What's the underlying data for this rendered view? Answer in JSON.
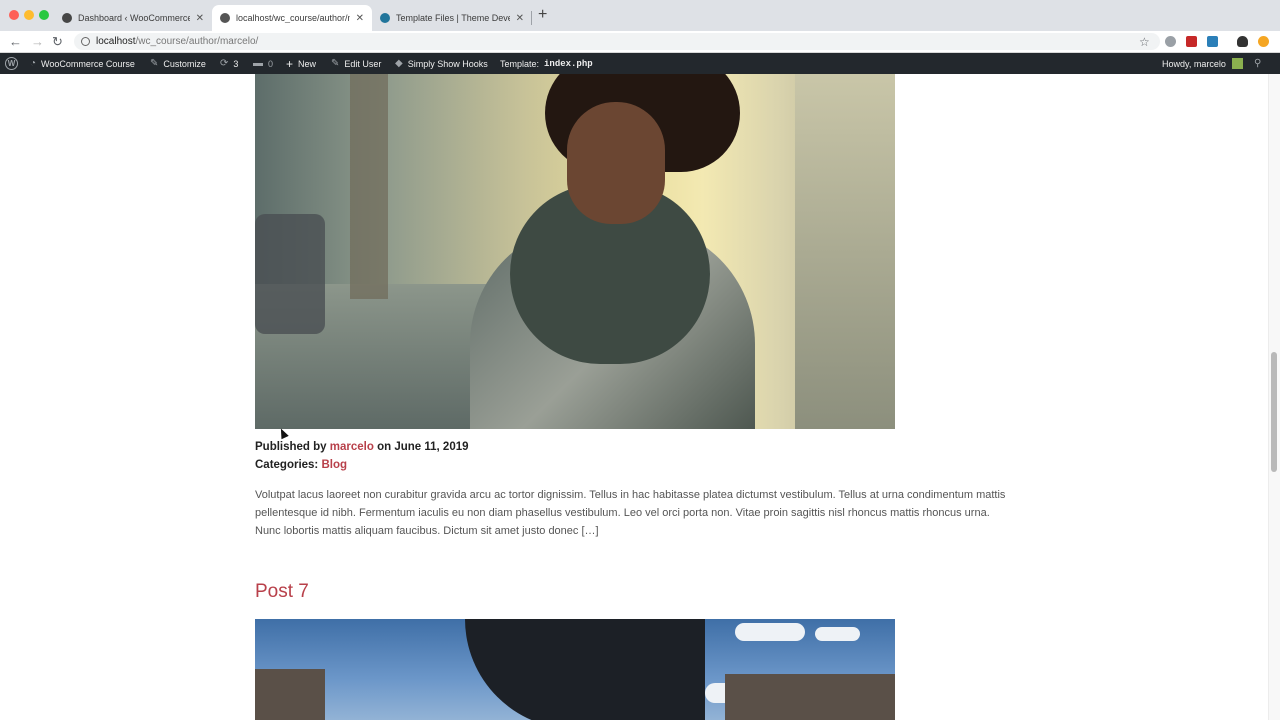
{
  "browser": {
    "tabs": [
      {
        "title": "Dashboard ‹ WooCommerce Co",
        "active": false
      },
      {
        "title": "localhost/wc_course/author/ma",
        "active": true
      },
      {
        "title": "Template Files | Theme Develo",
        "active": false
      }
    ],
    "url_host": "localhost",
    "url_path": "/wc_course/author/marcelo/"
  },
  "adminbar": {
    "site_name": "WooCommerce Course",
    "customize": "Customize",
    "updates_count": "3",
    "comments_count": "0",
    "new_label": "New",
    "edit_user": "Edit User",
    "hooks": "Simply Show Hooks",
    "template_label": "Template:",
    "template_file": "index.php",
    "howdy": "Howdy, marcelo"
  },
  "post": {
    "published_prefix": "Published by",
    "author": "marcelo",
    "date_text": "on June 11, 2019",
    "categories_label": "Categories:",
    "category": "Blog",
    "excerpt": "Volutpat lacus laoreet non curabitur gravida arcu ac tortor dignissim. Tellus in hac habitasse platea dictumst vestibulum. Tellus at urna condimentum mattis pellentesque id nibh. Fermentum iaculis eu non diam phasellus vestibulum. Leo vel orci porta non. Vitae proin sagittis nisl rhoncus mattis rhoncus urna. Nunc lobortis mattis aliquam faucibus. Dictum sit amet justo donec […]"
  },
  "next_post": {
    "title": "Post 7"
  },
  "colors": {
    "accent": "#b8404a",
    "adminbar": "#23282d"
  }
}
